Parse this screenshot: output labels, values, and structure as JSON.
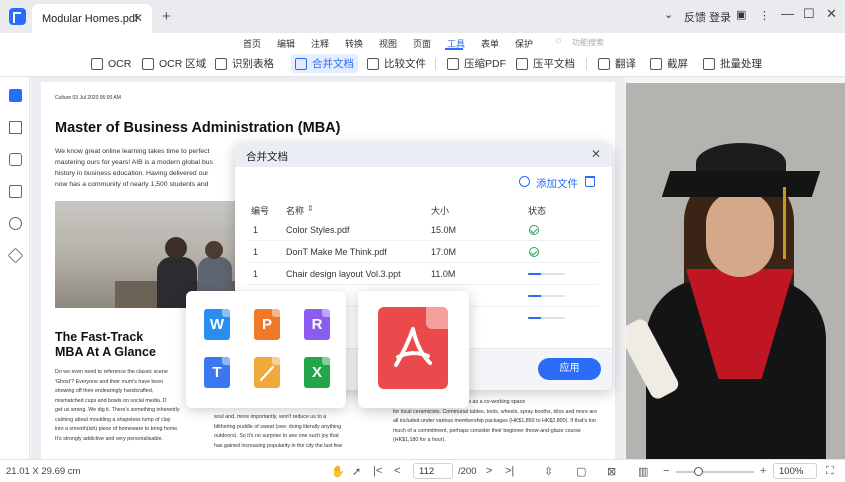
{
  "titlebar": {
    "tab_title": "Modular Homes.pdf",
    "feedback": "反馈",
    "login": "登录"
  },
  "menu": {
    "items": [
      "首页",
      "编辑",
      "注释",
      "转换",
      "视图",
      "页面",
      "工具",
      "表单",
      "保护"
    ],
    "active": "工具",
    "search_placeholder": "功能搜索"
  },
  "toolbar": {
    "tools": [
      "OCR",
      "OCR 区域",
      "识别表格",
      "合并文档",
      "比较文件",
      "压缩PDF",
      "压平文档",
      "翻译",
      "截屏",
      "批量处理"
    ],
    "active": "合并文档"
  },
  "document": {
    "date": "Culture 03 Jul 2020 06:00 AM",
    "title": "Master of Business Administration (MBA)",
    "intro_lines": [
      "We know great online learning takes time to perfect",
      "mastering ours for years! AIB is a modern global bus",
      "history in business education. Having delivered our",
      "now has a community of nearly 1,500 students and"
    ],
    "subtitle_line1": "The Fast-Track",
    "subtitle_line2": "MBA At A Glance",
    "left_col_lines": [
      "Do we even need to reference the classic scene",
      "'Ghost'? Everyone and their mum's have been",
      "showing off their endearingly handcrafted,",
      "mismatched cups and bowls on social media. D",
      "get us wrong. We dig it. There's something inherently",
      "calming about moulding a shapeless lump of clay",
      "into a smooth(ish) piece of homeware to bring home.",
      "It's strongly addictive and very personalisable."
    ],
    "mid_col_lines": [
      "soul and, more importantly, won't reduce us to a",
      "blithering puddle of sweat (see: doing literally anything",
      "outdoors). So it's no surprise to see one such joy that",
      "has gained increasing popularity in the city the last few"
    ],
    "mid_partial": "ut",
    "right_col_lines": [
      "nhe spacious studio also doubles as a co-working space",
      "for local ceramicists. Communal tables, tools, wheels, spray booths, kilns and more are",
      "all included under various membership packages (HK$1,850 to HK$2,800). If that's too",
      "much of a commitment, perhaps consider their beginner throw-and-glaze course",
      "(HK$1,180 for a hour)."
    ]
  },
  "dialog": {
    "title": "合并文档",
    "add_file": "添加文件",
    "columns": {
      "num": "编号",
      "name": "名称",
      "size": "大小",
      "status": "状态"
    },
    "rows": [
      {
        "num": "1",
        "name": "Color Styles.pdf",
        "size": "15.0M",
        "status": "done",
        "progress": 1.0
      },
      {
        "num": "1",
        "name": "DonT Make Me Think.pdf",
        "size": "17.0M",
        "status": "done",
        "progress": 1.0
      },
      {
        "num": "1",
        "name": "Chair design layout Vol.3.ppt",
        "size": "11.0M",
        "status": "progress",
        "progress": 0.35
      },
      {
        "status": "progress",
        "progress": 0.35
      },
      {
        "status": "progress",
        "progress": 0.35
      }
    ],
    "apply": "应用"
  },
  "file_types": {
    "icons": [
      {
        "letter": "W",
        "color": "#2a8df0"
      },
      {
        "letter": "P",
        "color": "#f07a2a"
      },
      {
        "letter": "R",
        "color": "#8a5cf0"
      },
      {
        "letter": "T",
        "color": "#3b78f0"
      },
      {
        "letter": "",
        "color": "#f2a93b"
      },
      {
        "letter": "X",
        "color": "#23a54a"
      }
    ]
  },
  "statusbar": {
    "dimensions": "21.01 X 29.69 cm",
    "page_current": "112",
    "page_total": "/200",
    "zoom": "100%"
  },
  "colors": {
    "accent": "#2b6cf6",
    "success": "#21a55b",
    "pdf_red": "#ea4a4c"
  }
}
